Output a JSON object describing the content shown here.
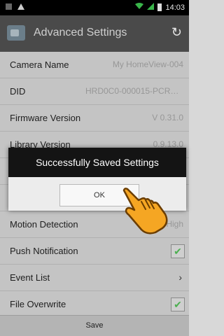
{
  "status": {
    "time": "14:03"
  },
  "header": {
    "title": "Advanced Settings",
    "refresh_icon": "refresh-icon"
  },
  "rows": [
    {
      "label": "Camera Name",
      "value": "My HomeView-004"
    },
    {
      "label": "DID",
      "value": "HRD0C0-000015-PCRHCY-..."
    },
    {
      "label": "Firmware Version",
      "value": "V 0.31.0"
    },
    {
      "label": "Library Version",
      "value": "0.9.13.0"
    },
    {
      "label": "",
      "value": ""
    },
    {
      "label": "",
      "value": ""
    },
    {
      "label": "Motion Detection",
      "value": "High"
    },
    {
      "label": "Push Notification",
      "checked": true
    },
    {
      "label": "Event List"
    },
    {
      "label": "File Overwrite",
      "checked": true
    }
  ],
  "footer": {
    "save_label": "Save"
  },
  "dialog": {
    "message": "Successfully Saved Settings",
    "ok_label": "OK"
  },
  "colors": {
    "action_bar": "#4a4a4a",
    "check": "#4caf50",
    "dialog_header": "#141414",
    "hand": "#f5a623"
  }
}
